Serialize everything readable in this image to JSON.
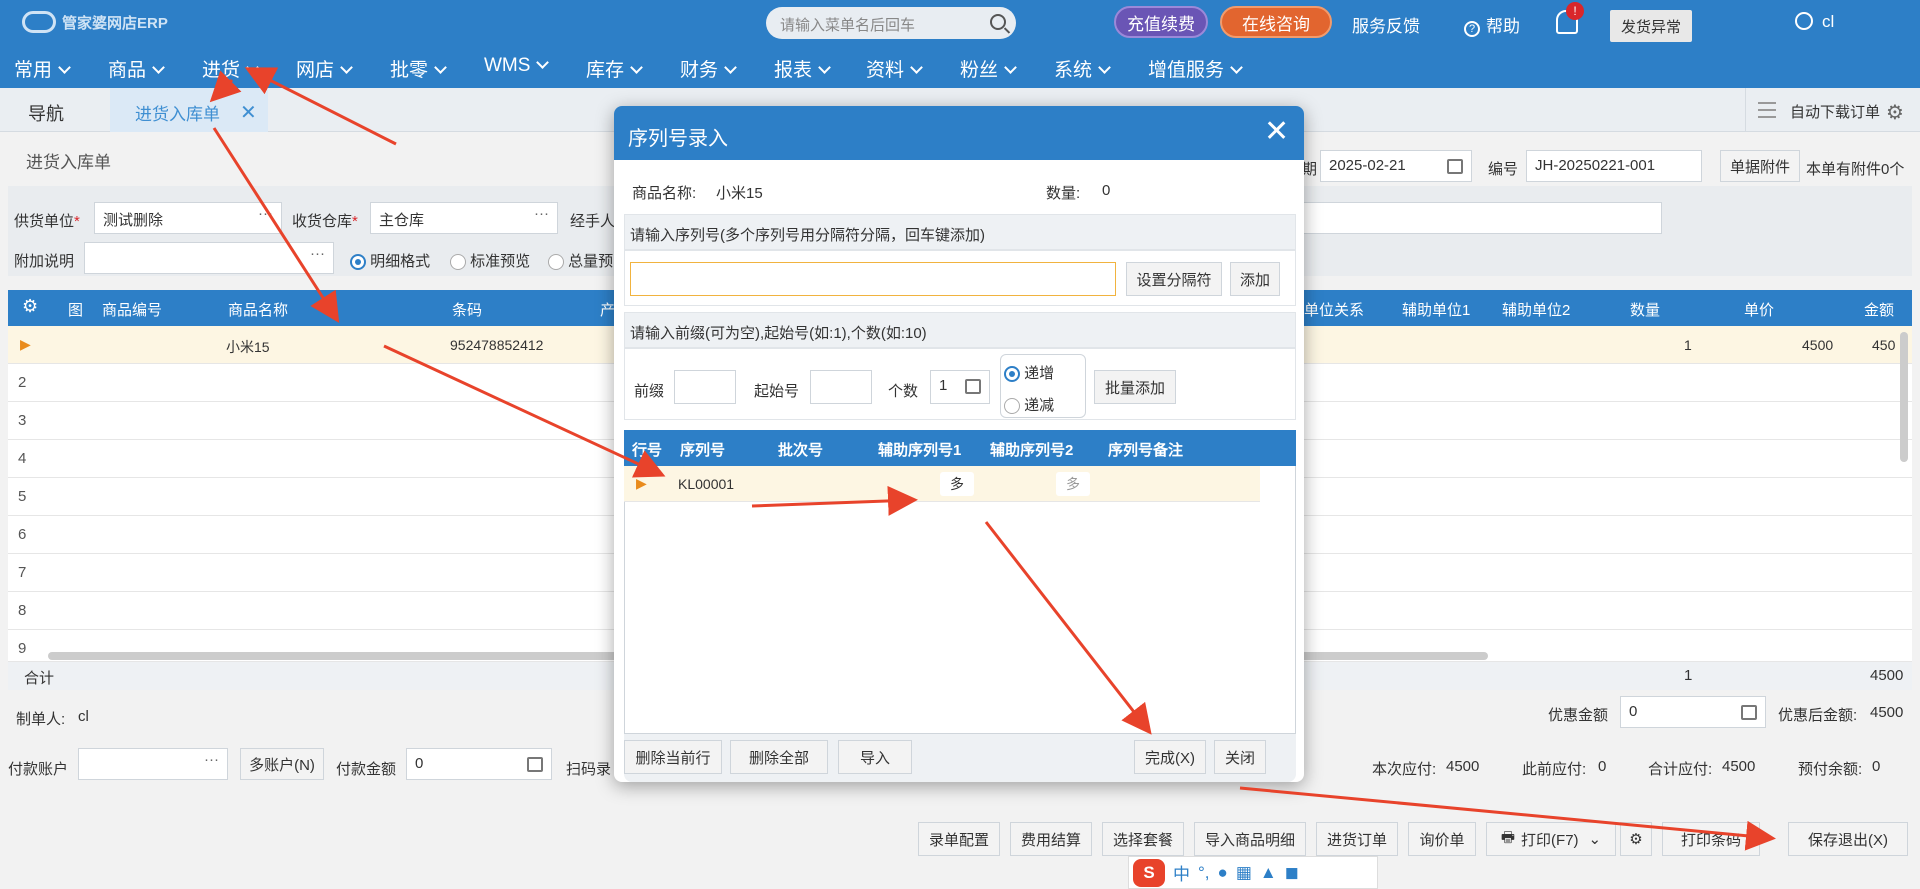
{
  "app": {
    "title": "管家婆网店ERP"
  },
  "topbar": {
    "search_placeholder": "请输入菜单名后回车",
    "recharge": "充值续费",
    "consult": "在线咨询",
    "feedback": "服务反馈",
    "help": "帮助",
    "bell_badge": "!",
    "ship_exception": "发货异常",
    "user": "cl"
  },
  "menu": [
    "常用",
    "商品",
    "进货",
    "网店",
    "批零",
    "WMS",
    "库存",
    "财务",
    "报表",
    "资料",
    "粉丝",
    "系统",
    "增值服务"
  ],
  "tabs": {
    "nav": "导航",
    "active": "进货入库单",
    "auto_download": "自动下载订单"
  },
  "form": {
    "page_title": "进货入库单",
    "supplier_label": "供货单位",
    "supplier_value": "测试删除",
    "warehouse_label": "收货仓库",
    "warehouse_value": "主仓库",
    "handler_label": "经手人",
    "remark_label": "附加说明",
    "mode_options": [
      "明细格式",
      "标准预览",
      "总量预"
    ],
    "date_label": "期",
    "date_value": "2025-02-21",
    "number_label": "编号",
    "number_value": "JH-20250221-001",
    "attach_btn": "单据附件",
    "attach_info": "本单有附件0个"
  },
  "grid": {
    "headers_left": [
      "图",
      "商品编号",
      "商品名称",
      "条码",
      "产"
    ],
    "headers_right": [
      "单位关系",
      "辅助单位1",
      "辅助单位2",
      "数量",
      "单价",
      "金额"
    ],
    "row1": {
      "name": "小米15",
      "barcode": "952478852412",
      "qty": "1",
      "price": "4500",
      "amount": "450"
    },
    "row_numbers": [
      "2",
      "3",
      "4",
      "5",
      "6",
      "7",
      "8",
      "9"
    ],
    "sum_label": "合计",
    "sum_qty": "1",
    "sum_amount": "4500"
  },
  "footer": {
    "creator_label": "制单人:",
    "creator": "cl",
    "discount_label": "优惠金额",
    "discount_value": "0",
    "after_discount_label": "优惠后金额:",
    "after_discount_value": "4500",
    "pay_account_label": "付款账户",
    "multi_account": "多账户(N)",
    "pay_amount_label": "付款金额",
    "pay_amount_value": "0",
    "scan_label": "扫码录",
    "payable_label": "本次应付:",
    "payable_value": "4500",
    "prev_payable_label": "此前应付:",
    "prev_payable_value": "0",
    "total_payable_label": "合计应付:",
    "total_payable_value": "4500",
    "prepaid_label": "预付余额:",
    "prepaid_value": "0",
    "buttons": [
      "录单配置",
      "费用结算",
      "选择套餐",
      "导入商品明细",
      "进货订单",
      "询价单",
      "打印(F7)",
      "打印条码",
      "保存退出(X)"
    ]
  },
  "modal": {
    "title": "序列号录入",
    "product_label": "商品名称:",
    "product_value": "小米15",
    "qty_label": "数量:",
    "qty_value": "0",
    "serial_hint": "请输入序列号(多个序列号用分隔符分隔，回车键添加)",
    "set_separator": "设置分隔符",
    "add": "添加",
    "batch_hint": "请输入前缀(可为空),起始号(如:1),个数(如:10)",
    "prefix_label": "前缀",
    "start_label": "起始号",
    "count_label": "个数",
    "count_value": "1",
    "inc": "递增",
    "dec": "递减",
    "batch_add": "批量添加",
    "table_headers": [
      "行号",
      "序列号",
      "批次号",
      "辅助序列号1",
      "辅助序列号2",
      "序列号备注"
    ],
    "row_serial": "KL00001",
    "multi": "多",
    "delete_row": "删除当前行",
    "delete_all": "删除全部",
    "import": "导入",
    "done": "完成(X)",
    "close": "关闭"
  },
  "ime": {
    "mode": "中"
  },
  "colors": {
    "primary": "#2d7fc7",
    "annotation_arrow": "#e8432b",
    "recharge": "#6a55b5",
    "consult": "#e2652f"
  }
}
